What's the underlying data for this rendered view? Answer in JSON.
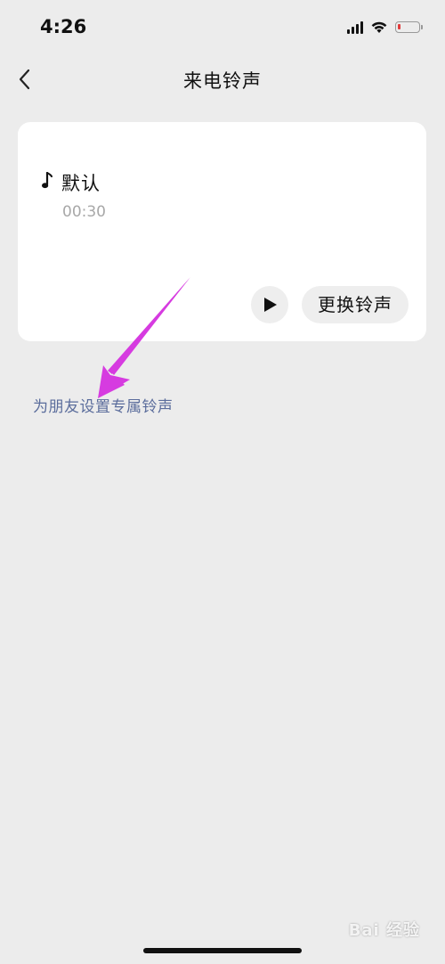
{
  "status_bar": {
    "time": "4:26",
    "battery_level": 0.15,
    "battery_color": "#e23b3b",
    "icons": [
      "signal-icon",
      "wifi-icon",
      "battery-icon"
    ]
  },
  "nav": {
    "title": "来电铃声",
    "back_icon": "chevron-left-icon"
  },
  "ringtone_card": {
    "name": "默认",
    "duration": "00:30",
    "icon": "music-note-icon",
    "play_icon": "play-icon",
    "change_label": "更换铃声"
  },
  "friend_link": {
    "label": "为朋友设置专属铃声",
    "color": "#5b6d9c"
  },
  "annotation": {
    "color": "#d63be0",
    "icon": "arrow-annotation"
  },
  "watermark": {
    "text": "Bai 经验"
  }
}
